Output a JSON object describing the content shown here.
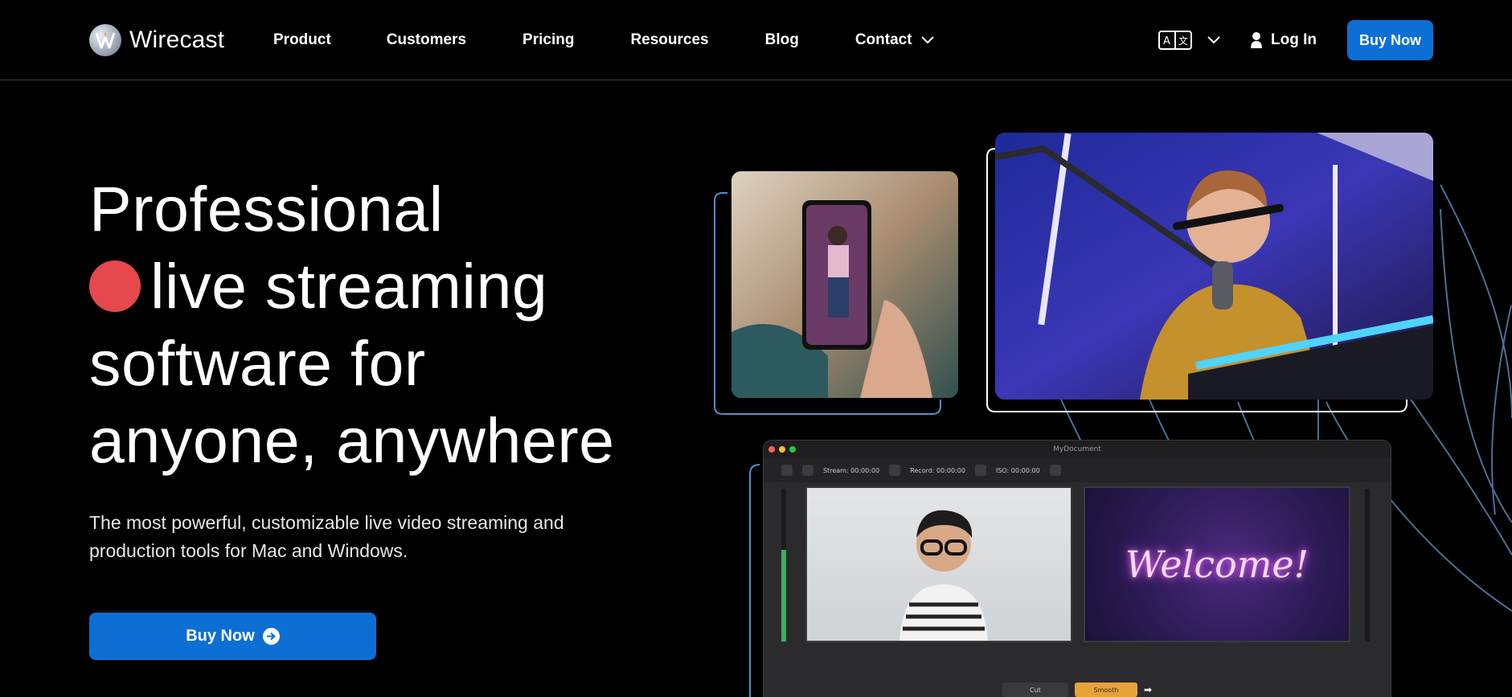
{
  "brand": {
    "name": "Wirecast",
    "logo_icon": "wirecast-logo-icon"
  },
  "nav": {
    "items": [
      {
        "label": "Product"
      },
      {
        "label": "Customers"
      },
      {
        "label": "Pricing"
      },
      {
        "label": "Resources"
      },
      {
        "label": "Blog"
      },
      {
        "label": "Contact",
        "has_dropdown": true
      }
    ]
  },
  "header_tools": {
    "language_icon": "translate-icon",
    "login_label": "Log In",
    "buy_label": "Buy Now"
  },
  "hero": {
    "headline_lines": [
      "Professional",
      "live streaming",
      "software for",
      "anyone, anywhere"
    ],
    "subtext": "The most powerful, customizable live video streaming and production tools for Mac and Windows.",
    "cta_label": "Buy Now"
  },
  "app_preview": {
    "document_title": "MyDocument",
    "stream_label": "Stream: 00:00:00",
    "record_label": "Record: 00:00:00",
    "iso_label": "ISO: 00:00:00",
    "welcome_text": "Welcome!",
    "transition_cut": "Cut",
    "transition_smooth": "Smooth"
  },
  "colors": {
    "background": "#000000",
    "accent_blue": "#0d6fd4",
    "live_dot_red": "#e5484d",
    "deco_line_blue": "#4c6f96"
  }
}
